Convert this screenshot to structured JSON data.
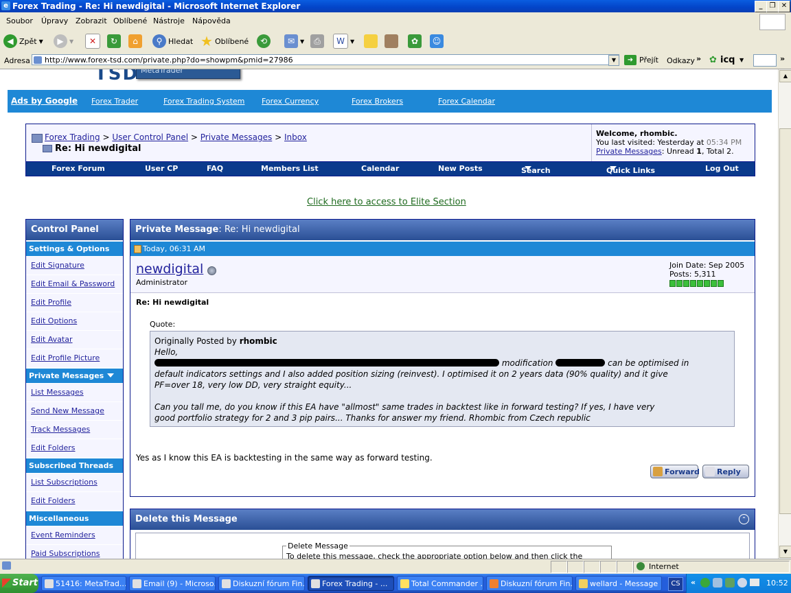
{
  "window": {
    "title": "Forex Trading - Re: Hi newdigital - Microsoft Internet Explorer"
  },
  "menu": [
    "Soubor",
    "Úpravy",
    "Zobrazit",
    "Oblíbené",
    "Nástroje",
    "Nápověda"
  ],
  "toolbar": {
    "back": "Zpět",
    "search": "Hledat",
    "favorites": "Oblíbené"
  },
  "address": {
    "label": "Adresa",
    "url": "http://www.forex-tsd.com/private.php?do=showpm&pmid=27986",
    "go": "Přejít",
    "links": "Odkazy",
    "icq": "icq"
  },
  "site": {
    "logo_text": "TSD",
    "logo_sub": "MetaTrader"
  },
  "ads": {
    "label": "Ads by Google",
    "links": [
      "Forex Trader",
      "Forex Trading System",
      "Forex Currency",
      "Forex Brokers",
      "Forex Calendar"
    ]
  },
  "breadcrumb": {
    "items": [
      "Forex Trading",
      "Private Messages",
      "Inbox"
    ],
    "control_panel": "User Control Panel",
    "sep": ">",
    "current": "Re: Hi newdigital"
  },
  "welcome": {
    "title": "Welcome, rhombic.",
    "last_visit_prefix": "You last visited: Yesterday at",
    "last_visit_time": "05:34 PM",
    "pm_link": "Private Messages",
    "pm_status_prefix": ": Unread",
    "unread": "1",
    "total_label": ", Total",
    "total": "2."
  },
  "navlinks": [
    "Forex Forum",
    "User CP",
    "FAQ",
    "Members List",
    "Calendar",
    "New Posts",
    "Search",
    "Quick Links",
    "Log Out"
  ],
  "elite_link": "Click here to access to Elite Section",
  "control_panel": {
    "title": "Control Panel",
    "settings_header": "Settings & Options",
    "settings_items": [
      "Edit Signature",
      "Edit Email & Password",
      "Edit Profile",
      "Edit Options",
      "Edit Avatar",
      "Edit Profile Picture"
    ],
    "pm_header": "Private Messages",
    "pm_items": [
      "List Messages",
      "Send New Message",
      "Track Messages",
      "Edit Folders"
    ],
    "subs_header": "Subscribed Threads",
    "subs_items": [
      "List Subscriptions",
      "Edit Folders"
    ],
    "misc_header": "Miscellaneous",
    "misc_items": [
      "Event Reminders",
      "Paid Subscriptions"
    ]
  },
  "message": {
    "header_prefix": "Private Message",
    "header_subject": ": Re: Hi newdigital",
    "date": "Today, 06:31 AM",
    "username": "newdigital",
    "role": "Administrator",
    "join_date": "Join Date: Sep 2005",
    "posts": "Posts: 5,311",
    "subject": "Re: Hi newdigital",
    "quote_label": "Quote:",
    "quote_by_prefix": "Originally Posted by",
    "quote_author": "rhombic",
    "quote_hello": "Hello,",
    "quote_mid1": "modification",
    "quote_mid2": "can be optimised in",
    "quote_line2": "default indicators settings and I also added position sizing (reinvest). I optimised it on 2 years data (90% quality) and it give",
    "quote_line3": "PF=over 18, very low DD, very straight equity...",
    "quote_line4": "Can you tall me, do you know if this EA have \"allmost\" same trades in backtest like in forward testing? If yes, I have very",
    "quote_line5": "good portfolio strategy for 2 and 3 pip pairs... Thanks for answer my friend. Rhombic from Czech republic",
    "reply_text": "Yes as I know this EA is backtesting in the same way as forward testing.",
    "forward_btn": "Forward",
    "reply_btn": "Reply"
  },
  "delete": {
    "title": "Delete this Message",
    "legend": "Delete Message",
    "text": "To delete this message, check the appropriate option below and then click the"
  },
  "status": {
    "zone": "Internet"
  },
  "taskbar": {
    "start": "Start",
    "tasks": [
      "51416: MetaTrad...",
      "Email (9) - Microso...",
      "Diskuzní fórum Fin...",
      "Forex Trading - ...",
      "Total Commander ...",
      "Diskuzní fórum Fin...",
      "wellard - Message"
    ],
    "lang": "CS",
    "clock": "10:52"
  }
}
